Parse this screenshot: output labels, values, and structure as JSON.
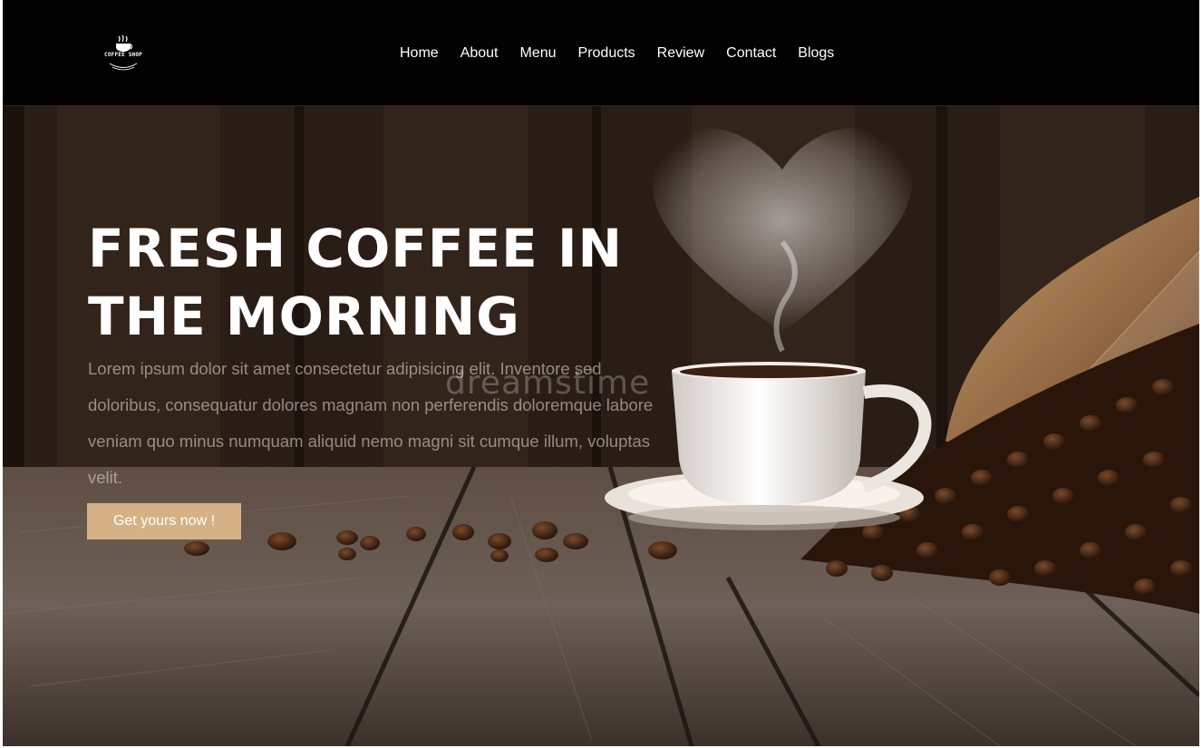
{
  "brand": {
    "logo_text": "COFFEE SHOP"
  },
  "nav": {
    "items": [
      {
        "label": "Home"
      },
      {
        "label": "About"
      },
      {
        "label": "Menu"
      },
      {
        "label": "Products"
      },
      {
        "label": "Review"
      },
      {
        "label": "Contact"
      },
      {
        "label": "Blogs"
      }
    ]
  },
  "hero": {
    "title_line1": "FRESH COFFEE IN",
    "title_line2": "THE MORNING",
    "description": "Lorem ipsum dolor sit amet consectetur adipisicing elit. Inventore sed doloribus, consequatur dolores magnam non perferendis doloremque labore veniam quo minus numquam aliquid nemo magni sit cumque illum, voluptas velit.",
    "cta_label": "Get yours now !",
    "watermark": "dreamstime"
  },
  "colors": {
    "header_bg": "#020202",
    "accent": "#d4b285",
    "text_light": "#ffffff"
  }
}
